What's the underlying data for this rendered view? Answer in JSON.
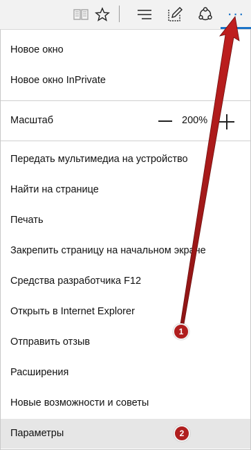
{
  "toolbar": {
    "icons": [
      "reading-view-icon",
      "favorite-star-icon",
      "hub-icon",
      "web-note-icon",
      "share-icon",
      "more-actions-icon"
    ],
    "more_label": "···",
    "accent_color": "#1a73c7"
  },
  "menu": {
    "new_window": "Новое окно",
    "new_inprivate": "Новое окно InPrivate",
    "zoom_label": "Масштаб",
    "zoom_value": "200%",
    "cast_media": "Передать мультимедиа на устройство",
    "find_on_page": "Найти на странице",
    "print": "Печать",
    "pin_to_start": "Закрепить страницу на начальном экране",
    "dev_tools": "Средства разработчика F12",
    "open_ie": "Открыть в Internet Explorer",
    "send_feedback": "Отправить отзыв",
    "extensions": "Расширения",
    "whats_new": "Новые возможности и советы",
    "settings": "Параметры"
  },
  "annotations": {
    "badge1": "1",
    "badge2": "2",
    "badge_color": "#b01e1e"
  }
}
